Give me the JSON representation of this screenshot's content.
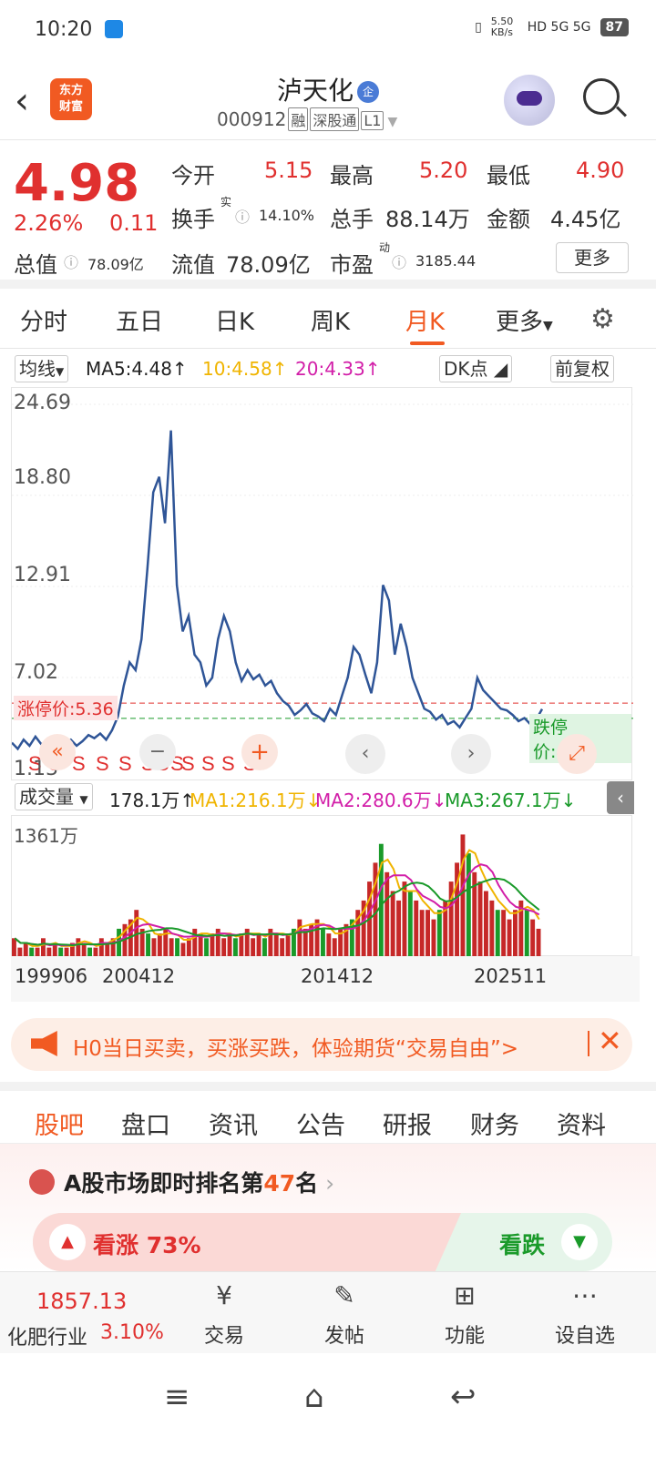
{
  "status": {
    "time": "10:20",
    "net_speed": "5.50 KB/s",
    "network": "HD 5G 5G",
    "battery": "87"
  },
  "header": {
    "title": "泸天化",
    "title_badge": "企",
    "code": "000912",
    "tags": [
      "融",
      "深股通",
      "L1"
    ],
    "logo_text": "东方财富"
  },
  "quote": {
    "price": "4.98",
    "pct": "2.26%",
    "change": "0.11",
    "open_label": "今开",
    "open": "5.15",
    "high_label": "最高",
    "high": "5.20",
    "low_label": "最低",
    "low": "4.90",
    "turnover_label": "换手",
    "turnover_sup": "实",
    "turnover": "14.10%",
    "volume_label": "总手",
    "volume": "88.14万",
    "amount_label": "金额",
    "amount": "4.45亿",
    "mcap_label": "总值",
    "mcap": "78.09亿",
    "float_label": "流值",
    "float": "78.09亿",
    "pe_label": "市盈",
    "pe_sup": "动",
    "pe": "3185.44",
    "more": "更多"
  },
  "ktabs": [
    "分时",
    "五日",
    "日K",
    "周K",
    "月K",
    "更多"
  ],
  "ma_line": {
    "select": "均线",
    "ma5": "MA5:4.48↑",
    "ma10": "10:4.58↑",
    "ma20": "20:4.33↑",
    "dk": "DK点",
    "adjust": "前复权"
  },
  "chart_data": {
    "type": "line",
    "title": "",
    "y_ticks": [
      "24.69",
      "18.80",
      "12.91",
      "7.02",
      "1.13"
    ],
    "ylim": [
      1.13,
      24.69
    ],
    "limit_up_label": "涨停价:5.36",
    "limit_down_label": "跌停价:4.38",
    "limit_up": 5.36,
    "limit_down": 4.38,
    "x_ticks": [
      "199906",
      "200412",
      "201412",
      "202511"
    ],
    "close_series": [
      2.8,
      2.4,
      3.0,
      2.6,
      3.2,
      2.7,
      2.9,
      3.1,
      2.5,
      2.8,
      3.0,
      2.6,
      2.9,
      3.3,
      3.1,
      3.4,
      3.0,
      3.6,
      4.5,
      6.5,
      8.0,
      7.5,
      9.5,
      14,
      19,
      20,
      17,
      23,
      13,
      10,
      11,
      8.5,
      8.0,
      6.5,
      7.0,
      9.5,
      11,
      10,
      8.0,
      6.8,
      7.5,
      6.9,
      7.2,
      6.5,
      6.8,
      6.0,
      5.5,
      5.2,
      4.6,
      4.9,
      5.3,
      4.7,
      4.5,
      4.2,
      5.0,
      4.6,
      5.8,
      7.0,
      9.0,
      8.5,
      7.2,
      6.0,
      8.0,
      13,
      12,
      8.5,
      10.5,
      9.0,
      7.0,
      6.0,
      5.0,
      4.8,
      4.3,
      4.6,
      4.0,
      4.2,
      3.8,
      4.4,
      5.0,
      7.0,
      6.2,
      5.8,
      5.4,
      5.0,
      4.9,
      4.6,
      4.2,
      4.4,
      4.0,
      4.3,
      4.98
    ],
    "markers": [
      "S",
      "S",
      "S",
      "S",
      "S",
      "S",
      "S",
      "S",
      "S",
      "S",
      "S",
      "S"
    ]
  },
  "vol_line": {
    "select": "成交量",
    "vol": "178.1万↑",
    "ma1": "MA1:216.1万↓",
    "ma2": "MA2:280.6万↓",
    "ma3": "MA3:267.1万↓",
    "vol_max": "1361万"
  },
  "vol_chart_data": {
    "type": "bar",
    "values": [
      2,
      1,
      1.5,
      1,
      1,
      2,
      1,
      1.5,
      1,
      1,
      1.5,
      2,
      1.5,
      1,
      1,
      2,
      1.5,
      2,
      3,
      3.5,
      4,
      5,
      3,
      2.5,
      2,
      2.5,
      3,
      2,
      2,
      1.5,
      2,
      3,
      2.5,
      2,
      2.5,
      3,
      2,
      2.5,
      2,
      2.5,
      3,
      2,
      2.5,
      2,
      3,
      2.5,
      2,
      2.5,
      3,
      4,
      3,
      3.5,
      4,
      3,
      2.5,
      2,
      3,
      3.5,
      4,
      5,
      6,
      8,
      10,
      12,
      9,
      7,
      6,
      8,
      7,
      6,
      5,
      5,
      4,
      5,
      6,
      8,
      10,
      13,
      11,
      9,
      8,
      7,
      6,
      5,
      5,
      4,
      5,
      6,
      5,
      4,
      3
    ]
  },
  "banner": {
    "text": "H0当日买卖，买涨买跌，体验期货“交易自由”>"
  },
  "gtabs": [
    "股吧",
    "盘口",
    "资讯",
    "公告",
    "研报",
    "财务",
    "资料"
  ],
  "rank": {
    "prefix": "A股市场即时排名第",
    "num": "47",
    "suffix": "名"
  },
  "sentiment": {
    "up": "看涨 73%",
    "down": "看跌"
  },
  "bottom": {
    "index_value": "1857.13",
    "industry": "化肥行业",
    "industry_pct": "3.10%",
    "items": [
      "交易",
      "发帖",
      "功能",
      "设自选"
    ]
  },
  "colors": {
    "accent": "#f15a22",
    "up": "#e0302f",
    "down": "#1a9a2a",
    "line": "#2f5597"
  }
}
